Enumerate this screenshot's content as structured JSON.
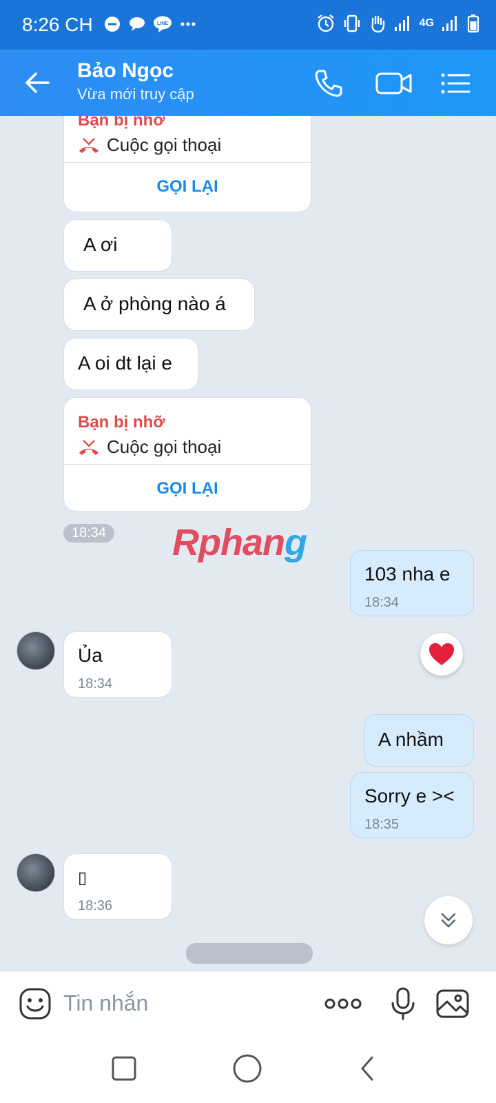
{
  "status_bar": {
    "time": "8:26 CH",
    "network_label": "4G"
  },
  "header": {
    "contact_name": "Bảo Ngọc",
    "contact_status": "Vừa mới truy cập"
  },
  "missed_call_label": "Bạn bị nhỡ",
  "call_type_label": "Cuộc gọi thoại",
  "recall_label": "GỌI LẠI",
  "messages": [
    {
      "text": "A ơi"
    },
    {
      "text": "A ở phòng nào á"
    },
    {
      "text": "A oi dt lại e"
    },
    {
      "time": "18:34"
    },
    {
      "text": "103 nha e",
      "time": "18:34"
    },
    {
      "text": "Ủa",
      "time": "18:34"
    },
    {
      "text": "A nhầm"
    },
    {
      "text": "Sorry e ><",
      "time": "18:35"
    },
    {
      "text": "▯",
      "time": "18:36"
    }
  ],
  "watermark": {
    "part1": "Rphan",
    "part2": "g"
  },
  "composer": {
    "placeholder": "Tin nhắn"
  },
  "colors": {
    "header_blue": "#1e97f8",
    "missed_red": "#e04a4a",
    "link_blue": "#1a8ae8",
    "sent_bubble": "#d6ecfc"
  }
}
